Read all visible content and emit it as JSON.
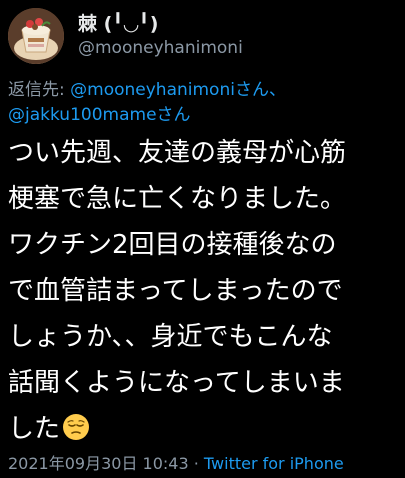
{
  "tweet": {
    "display_name": "棘 (╹◡╹)",
    "handle": "@mooneyhanimoni",
    "reply_label": "返信先: ",
    "reply_mention_1": "@mooneyhanimoniさん、",
    "reply_mention_2": "@jakku100mameさん",
    "lines": [
      "つい先週、友達の義母が心筋",
      "梗塞で急に亡くなりました。",
      "ワクチン2回目の接種後なの",
      "で血管詰まってしまったので",
      "しょうか、、身近でもこんな",
      "話聞くようになってしまいま",
      "した"
    ],
    "timestamp": "2021年09月30日 10:43",
    "separator": " · ",
    "source": "Twitter for iPhone",
    "emoji_icon": "pensive-face-icon"
  },
  "colors": {
    "background": "#000000",
    "text": "#ffffff",
    "secondary": "#8b98a5",
    "link": "#1d9bf0"
  }
}
